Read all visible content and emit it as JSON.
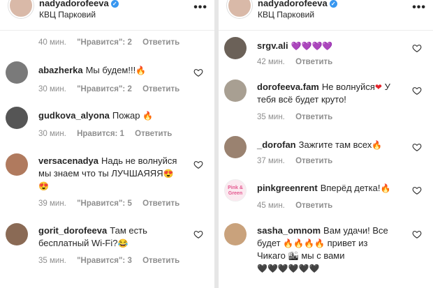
{
  "post_header": {
    "username": "nadyadorofeeva",
    "location": "КВЦ Парковий",
    "more": "•••"
  },
  "left": {
    "top_meta": {
      "time": "40 мин.",
      "likes": "\"Нравится\": 2",
      "reply": "Ответить"
    },
    "comments": [
      {
        "user": "abazherka",
        "text": "Мы будем!!!",
        "emoji": "🔥",
        "time": "30 мин.",
        "likes": "\"Нравится\": 2",
        "reply": "Ответить",
        "avatar_color": "#7a7a7a"
      },
      {
        "user": "gudkova_alyona",
        "text": "Пожар",
        "emoji": "🔥",
        "time": "30 мин.",
        "likes": "Нравится: 1",
        "reply": "Ответить",
        "avatar_color": "#555555"
      },
      {
        "user": "versacenadya",
        "text": "Надь не волнуйся мы знаем что ты ЛУЧШАЯЯЯ",
        "emoji": "😍",
        "emoji2": "😍",
        "time": "39 мин.",
        "likes": "\"Нравится\": 5",
        "reply": "Ответить",
        "avatar_color": "#b07a5e"
      },
      {
        "user": "gorit_dorofeeva",
        "text": "Там есть бесплатный Wi-Fi?",
        "emoji": "😂",
        "time": "35 мин.",
        "likes": "\"Нравится\": 3",
        "reply": "Ответить",
        "avatar_color": "#8a6a55"
      }
    ]
  },
  "right": {
    "comments": [
      {
        "user": "srgv.ali",
        "text": "",
        "emoji": "💜💜💜💜",
        "time": "42 мин.",
        "reply": "Ответить",
        "avatar_color": "#6b6158"
      },
      {
        "user": "dorofeeva.fam",
        "text": "Не волнуйся",
        "emoji": "❤",
        "text2": "У тебя всё будет круто!",
        "time": "35 мин.",
        "reply": "Ответить",
        "avatar_color": "#a89f92"
      },
      {
        "user": "_dorofan",
        "text": "Зажгите там всех",
        "emoji": "🔥",
        "time": "37 мин.",
        "reply": "Ответить",
        "avatar_color": "#9a8270"
      },
      {
        "user": "pinkgreenrent",
        "text": "Вперёд детка!",
        "emoji": "🔥",
        "time": "45 мин.",
        "reply": "Ответить",
        "avatar_label": "Pink & Green",
        "avatar_color": "#f6d7e3"
      },
      {
        "user": "sasha_omnom",
        "text": "Вам удачи! Все будет",
        "emoji": "🔥🔥🔥🔥",
        "text2": "привет из Чикаго",
        "emoji2": "🏙",
        "text3": "мы с вами",
        "emoji3": "🖤🖤🖤🖤🖤🖤",
        "avatar_color": "#c9a27c"
      }
    ]
  }
}
